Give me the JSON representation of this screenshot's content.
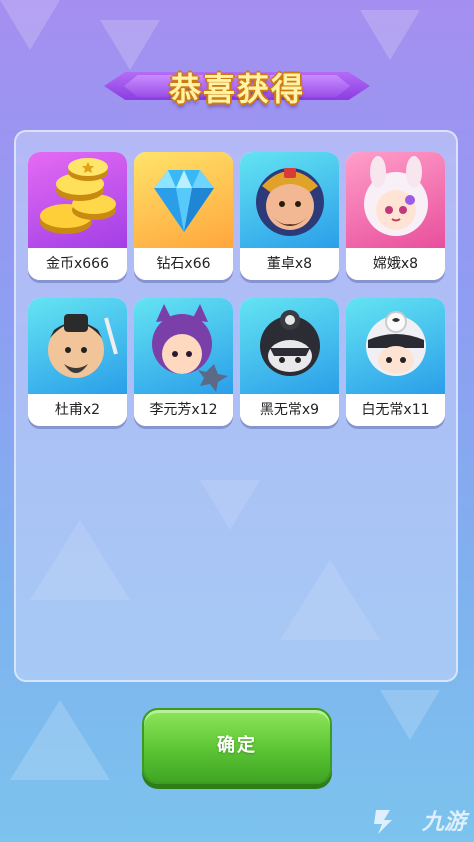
{
  "title": "恭喜获得",
  "items": [
    {
      "label": "金币x666",
      "icon": "gold-coins-icon",
      "bg": "#c056ee"
    },
    {
      "label": "钻石x66",
      "icon": "diamond-icon",
      "bg": "#ffc24e"
    },
    {
      "label": "董卓x8",
      "icon": "dongzhuo-avatar-icon",
      "bg": "#3fb7ec"
    },
    {
      "label": "嫦娥x8",
      "icon": "change-avatar-icon",
      "bg": "#f375b3"
    },
    {
      "label": "杜甫x2",
      "icon": "dufu-avatar-icon",
      "bg": "#3fb7ec"
    },
    {
      "label": "李元芳x12",
      "icon": "liyuanfang-avatar-icon",
      "bg": "#3fb7ec"
    },
    {
      "label": "黑无常x9",
      "icon": "heiwuchang-avatar-icon",
      "bg": "#3fb7ec"
    },
    {
      "label": "白无常x11",
      "icon": "baiwuchang-avatar-icon",
      "bg": "#3fb7ec"
    }
  ],
  "confirm_label": "确定",
  "watermark": "九游"
}
